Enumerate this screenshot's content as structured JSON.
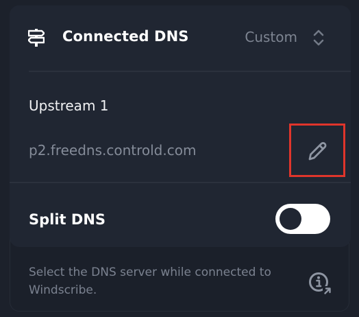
{
  "header": {
    "title": "Connected DNS",
    "mode": "Custom",
    "icon": "signpost-icon",
    "chevron_icon": "chevron-up-down-icon"
  },
  "upstream": {
    "title": "Upstream 1",
    "host": "p2.freedns.controld.com",
    "edit_icon": "pencil-icon"
  },
  "split_dns": {
    "label": "Split DNS",
    "enabled": true
  },
  "footer": {
    "description": "Select the DNS server while connected to Windscribe.",
    "info_icon": "info-icon"
  },
  "colors": {
    "background": "#1b202a",
    "card": "#202632",
    "highlight": "#e0352b",
    "text_primary": "#ffffff",
    "text_secondary": "#858c99"
  }
}
